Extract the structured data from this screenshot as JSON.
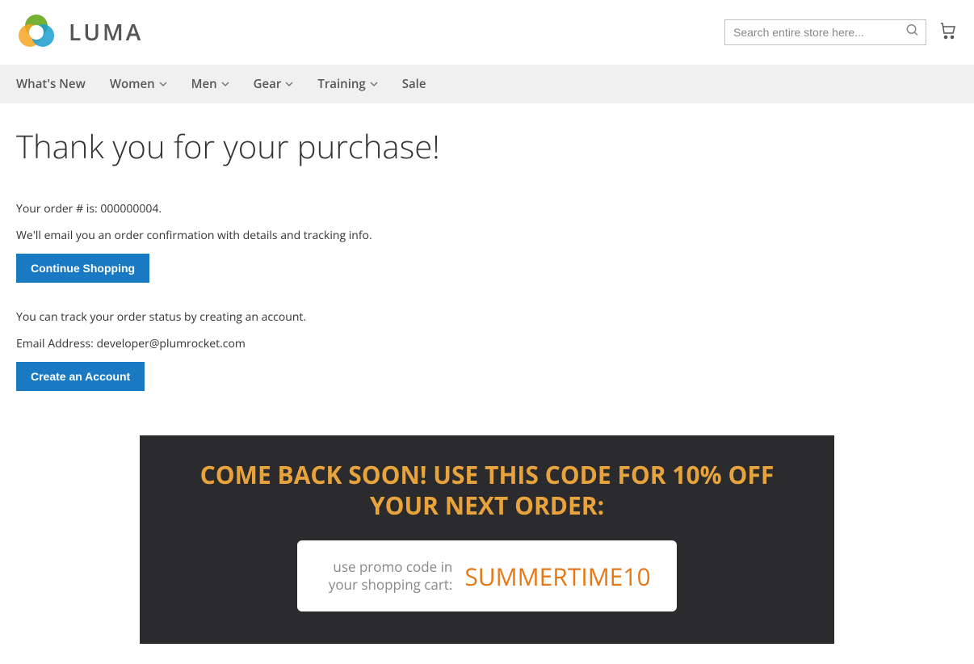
{
  "header": {
    "brand": "LUMA",
    "search_placeholder": "Search entire store here..."
  },
  "nav": {
    "items": [
      {
        "label": "What's New",
        "hasDropdown": false
      },
      {
        "label": "Women",
        "hasDropdown": true
      },
      {
        "label": "Men",
        "hasDropdown": true
      },
      {
        "label": "Gear",
        "hasDropdown": true
      },
      {
        "label": "Training",
        "hasDropdown": true
      },
      {
        "label": "Sale",
        "hasDropdown": false
      }
    ]
  },
  "page": {
    "title": "Thank you for your purchase!",
    "order_text": "Your order # is: 000000004.",
    "email_confirmation_text": "We'll email you an order confirmation with details and tracking info.",
    "continue_shopping_label": "Continue Shopping",
    "track_order_text": "You can track your order status by creating an account.",
    "email_label": "Email Address: developer@plumrocket.com",
    "create_account_label": "Create an Account"
  },
  "promo": {
    "heading": "COME BACK SOON! USE THIS CODE FOR 10% OFF YOUR NEXT ORDER:",
    "label": "use promo code in your shopping cart:",
    "code": "SUMMERTIME10"
  }
}
